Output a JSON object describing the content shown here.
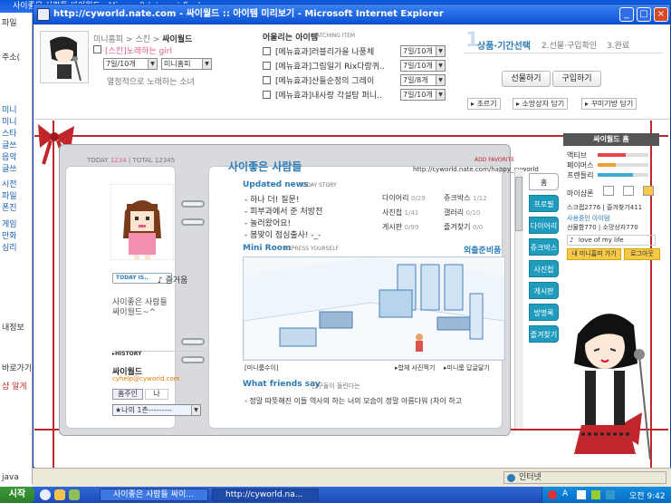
{
  "bg_window": {
    "title": "사이좋은 사람들 싸이월드 - Microsoft Internet Explorer",
    "side_labels": [
      "파일",
      "주소(",
      "미니",
      "미니",
      "스타",
      "글쓰",
      "음악",
      "글쓰",
      "시전",
      "파일",
      "폰진",
      "게임",
      "만화",
      "심리",
      "내정보",
      "바로가기",
      "샵 알게",
      "java"
    ]
  },
  "popup": {
    "title": "http://cyworld.nate.com - 싸이월드 :: 아이템 미리보기 - Microsoft Internet Explorer",
    "min": "_",
    "max": "□",
    "close": "×"
  },
  "item_info": {
    "breadcrumb": [
      "미니홈피",
      "스킨",
      "싸이월드"
    ],
    "item_name": "[스킨]노래하는 girl",
    "period": "7일/10개",
    "target": "미니홈피",
    "description": "열정적으로 노래하는 소녀"
  },
  "related": {
    "title": "어울리는 아이템",
    "subtitle": "MATCHING ITEM",
    "items": [
      {
        "name": "[메뉴효과]러블리가을 나풍체",
        "period": "7일/10개"
      },
      {
        "name": "[메뉴효과]그림일기 Rix다랑퀴..",
        "period": "7일/10개"
      },
      {
        "name": "[메뉴효과]산들순정의 그레이",
        "period": "7일/8개"
      },
      {
        "name": "[메뉴효과]내사랑 각설탕 퍼니..",
        "period": "7일/10개"
      }
    ]
  },
  "steps": {
    "num": "1",
    "step1": "상품·기간선택",
    "step2": "2.선물·구입확인",
    "step3": "3.완료"
  },
  "actions": {
    "gift": "선물하기",
    "buy": "구입하기",
    "sb1": "조르기",
    "sb2": "소망상자 담기",
    "sb3": "꾸미기방 담기"
  },
  "home": {
    "today_label": "TODAY",
    "today": "1234",
    "total_label": "TOTAL",
    "total": "12345",
    "title": "사이좋은 사람들",
    "add_fav": "ADD FAVORITE",
    "url": "http://cyworld.nate.com/happy_cyworld",
    "today_is": "TODAY IS..",
    "mood": "즐거움",
    "profile_text": "사이좋은 사람들\n싸이월드~^",
    "history": "HISTORY",
    "owner": "싸이월드",
    "email": "cyhelp@cyworld.com",
    "owner_tabs": [
      "홈주인",
      "나"
    ],
    "ilchon_select": "★나의 1촌---------"
  },
  "updated_news": {
    "title": "Updated news",
    "sub": "TODAY STORY",
    "items": [
      "하나 더! 질문!",
      "피부과에서 준 처방전",
      "놀러왔어요!",
      "봄맞이 점심출사! -_-"
    ]
  },
  "menu_counts": [
    {
      "name": "다이어리",
      "count": "0/29"
    },
    {
      "name": "쥬크박스",
      "count": "1/12"
    },
    {
      "name": "사진첩",
      "count": "1/41"
    },
    {
      "name": "갤러리",
      "count": "0/10"
    },
    {
      "name": "게시판",
      "count": "0/99"
    },
    {
      "name": "즐겨찾기",
      "count": "0/0"
    }
  ],
  "miniroom": {
    "title": "Mini Room",
    "sub": "EXPRESS YOURSELF",
    "right": "외출준비품",
    "bottom_left": "[미니룸수이]",
    "bottom_link1": "합체 사진찍기",
    "bottom_link2": "미니룸 답글달기"
  },
  "friends": {
    "title": "What friends say",
    "sub": "친구들이 돌린다는",
    "text": "- 정말 따뜻해진 이들 역사의 하는 너의 모습이 정말 아름다워 (차이 하고"
  },
  "nav_tabs": [
    "홈",
    "프로필",
    "다이어리",
    "쥬크박스",
    "사진첩",
    "게시판",
    "방명록",
    "즐겨찾기"
  ],
  "right_panel": {
    "title": "싸이월드 홈",
    "stats": [
      {
        "name": "액티브",
        "level": 0.55,
        "color": "#e84646"
      },
      {
        "name": "페이머스",
        "level": 0.35,
        "color": "#f0a030"
      },
      {
        "name": "프렌들리",
        "level": 0.7,
        "color": "#3fa8d8"
      }
    ],
    "mini_label": "마이샵론",
    "scrap": "스크랩",
    "scrap_count": "2776",
    "fav_label": "즐겨찾기",
    "fav_count": "411",
    "item_label": "사용중인 아이템",
    "gift_label": "선물함",
    "gift_count": "770",
    "wish_label": "소망상자",
    "wish_count": "770",
    "bgm": "love of my life",
    "btn_myhome": "내 미니홈피 가기",
    "btn_logout": "로그아웃"
  },
  "statusbar": {
    "zone": "인터넷"
  },
  "taskbar": {
    "start": "시작",
    "task1": "사이좋은 사람들 싸이...",
    "task2": "http://cyworld.na...",
    "lang": "A",
    "time": "오전 9:42"
  }
}
